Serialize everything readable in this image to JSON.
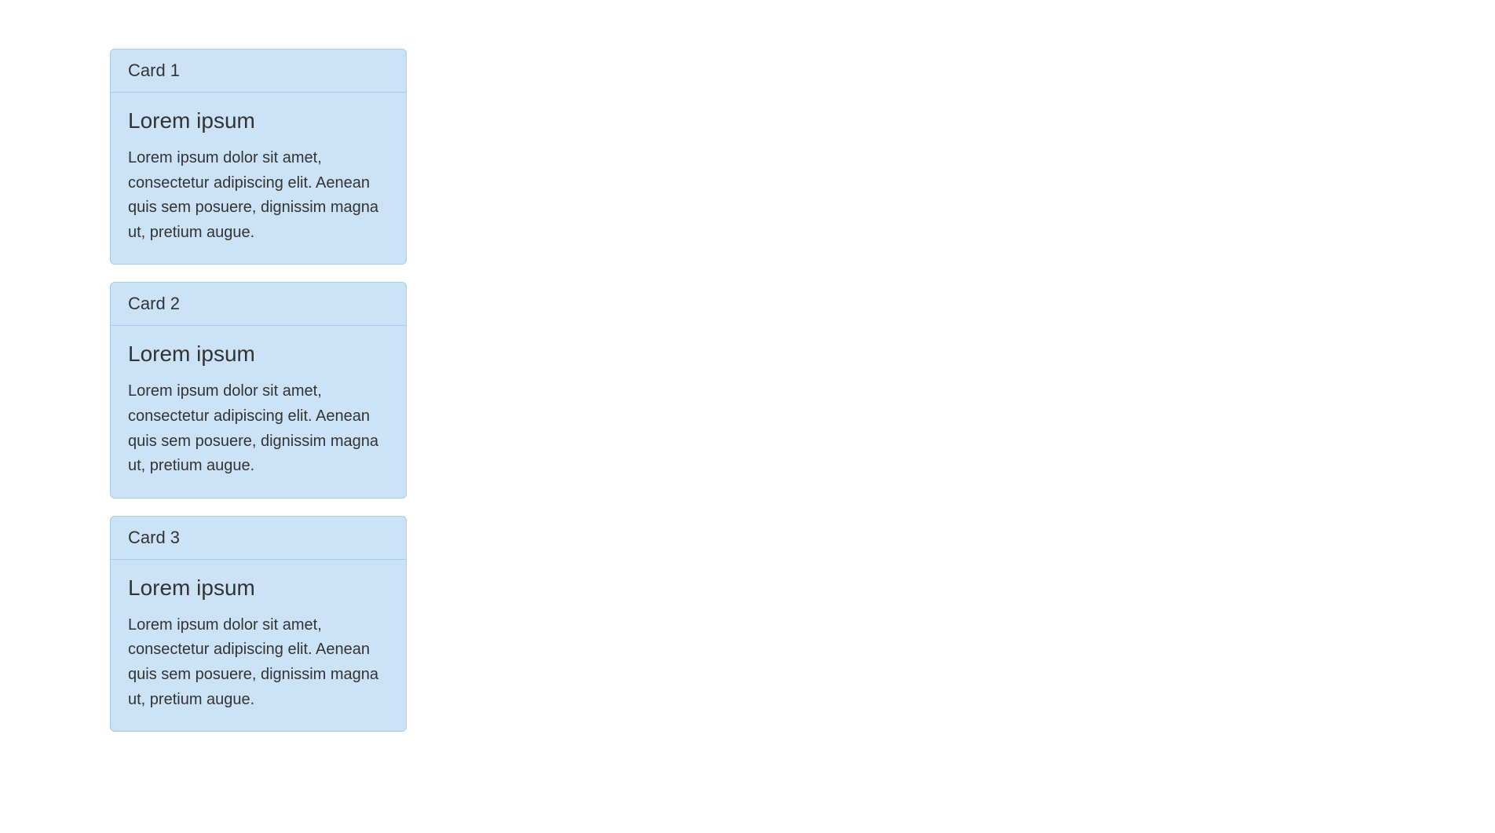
{
  "cards": [
    {
      "header": "Card 1",
      "title": "Lorem ipsum",
      "text": "Lorem ipsum dolor sit amet, consectetur adipiscing elit. Aenean quis sem posuere, dignissim magna ut, pretium augue."
    },
    {
      "header": "Card 2",
      "title": "Lorem ipsum",
      "text": "Lorem ipsum dolor sit amet, consectetur adipiscing elit. Aenean quis sem posuere, dignissim magna ut, pretium augue."
    },
    {
      "header": "Card 3",
      "title": "Lorem ipsum",
      "text": "Lorem ipsum dolor sit amet, consectetur adipiscing elit. Aenean quis sem posuere, dignissim magna ut, pretium augue."
    }
  ]
}
